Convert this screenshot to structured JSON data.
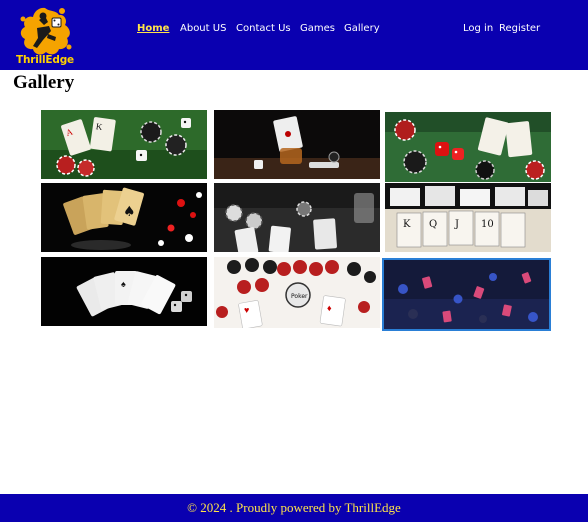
{
  "brand": {
    "name": "ThrillEdge"
  },
  "nav": {
    "items": [
      "Home",
      "About US",
      "Contact Us",
      "Games",
      "Gallery"
    ],
    "active": "Home",
    "auth": [
      "Log in",
      "Register"
    ]
  },
  "page": {
    "title": "Gallery"
  },
  "gallery": {
    "tiles": [
      "cards-chips-dice-green-felt",
      "card-whiskey-dice-dark-table",
      "red-dice-chips-green-felt",
      "golden-royal-flush-chips",
      "cards-chips-grey-table",
      "poker-chips-stacks-cards",
      "cards-fan-dice-black",
      "red-chips-cards-white",
      "blue-glowing-cards-chips"
    ],
    "selected_index": 8
  },
  "footer": {
    "text": "© 2024 . Proudly powered by ThrillEdge"
  },
  "colors": {
    "header_bg": "#0a00b0",
    "accent_yellow": "#ffe34a",
    "logo_orange": "#f5a300"
  }
}
